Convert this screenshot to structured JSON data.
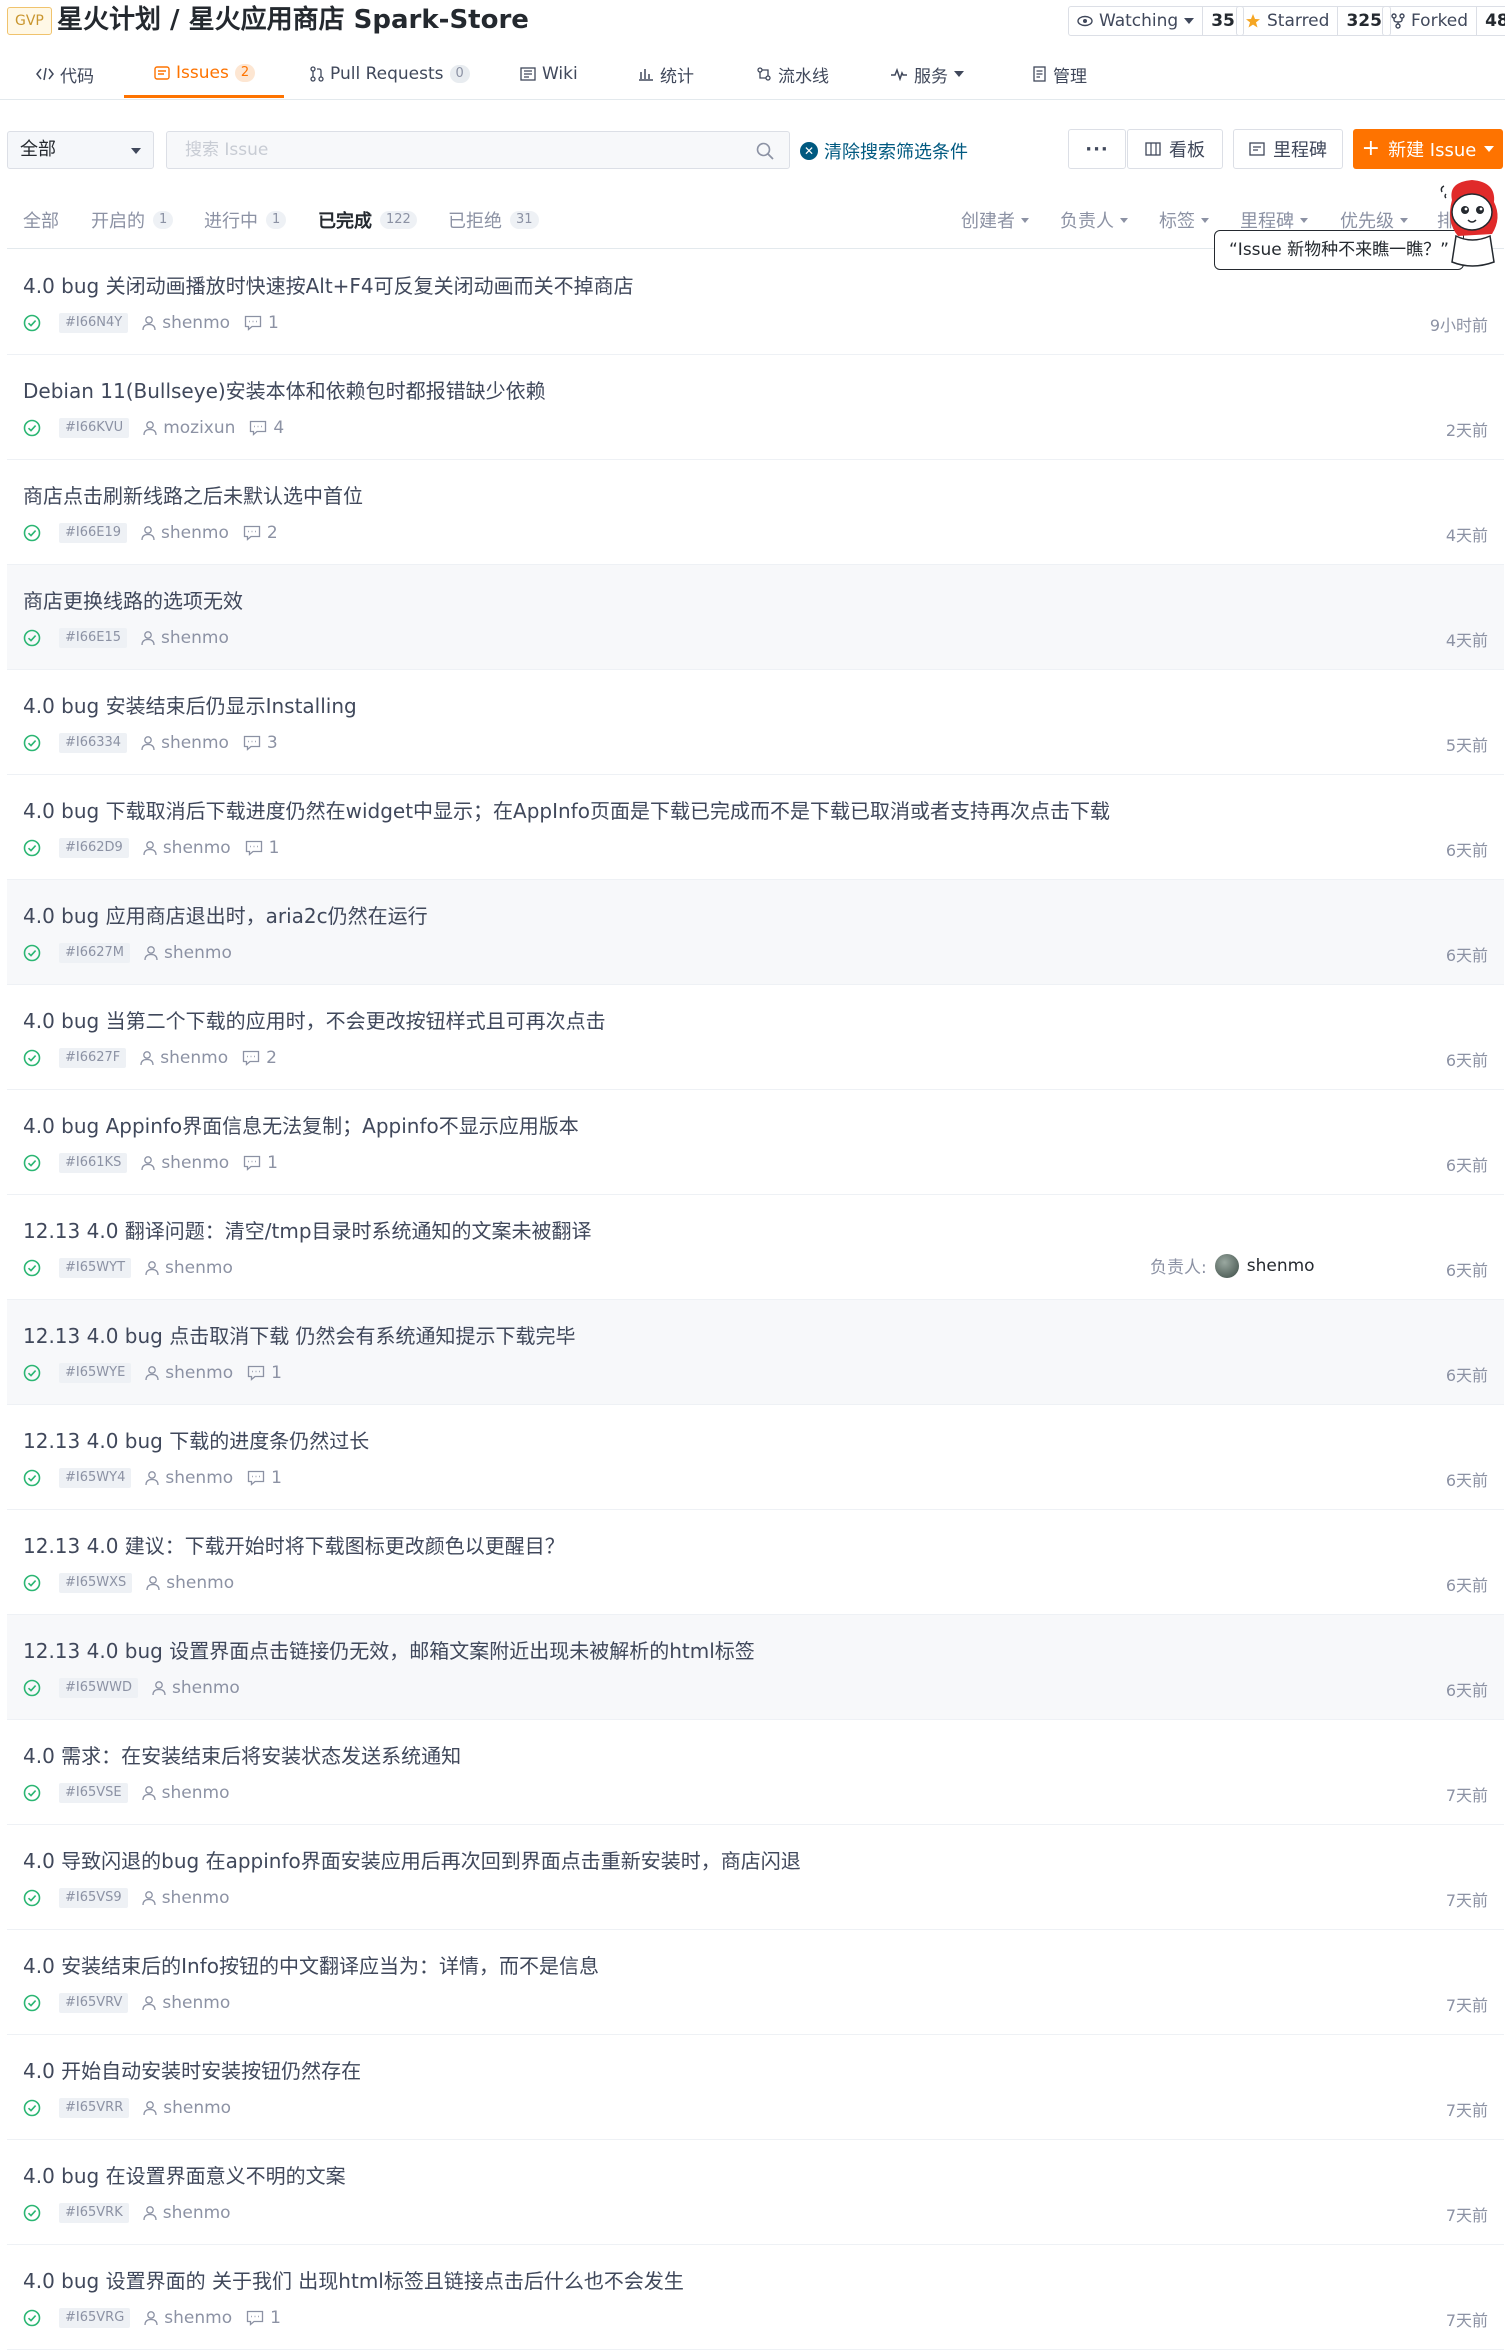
{
  "repo": {
    "badge": "GVP",
    "title": "星火计划 / 星火应用商店 Spark-Store"
  },
  "social": {
    "watching_label": "Watching",
    "watching_count": "35",
    "starred_label": "Starred",
    "starred_count": "325",
    "forked_label": "Forked",
    "forked_count": "48"
  },
  "tabs": {
    "code": "代码",
    "issues": "Issues",
    "issues_count": "2",
    "pulls": "Pull Requests",
    "pulls_count": "0",
    "wiki": "Wiki",
    "stats": "统计",
    "pipeline": "流水线",
    "services": "服务",
    "manage": "管理"
  },
  "toolbar": {
    "scope_value": "全部",
    "search_placeholder": "搜索 Issue",
    "clear_label": "清除搜索筛选条件",
    "more_label": "···",
    "board_label": "看板",
    "milestone_label": "里程碑",
    "new_issue_label": "新建 Issue"
  },
  "filters": {
    "all": "全部",
    "open": "开启的",
    "open_count": "1",
    "progress": "进行中",
    "progress_count": "1",
    "done": "已完成",
    "done_count": "122",
    "rejected": "已拒绝",
    "rejected_count": "31",
    "creator": "创建者",
    "assignee": "负责人",
    "labels": "标签",
    "milestone": "里程碑",
    "priority": "优先级",
    "sort_partial": "排"
  },
  "mascot": {
    "bubble": "“Issue 新物种不来瞧一瞧？”"
  },
  "issues": [
    {
      "title": "4.0 bug 关闭动画播放时快速按Alt+F4可反复关闭动画而关不掉商店",
      "id": "#I66N4Y",
      "author": "shenmo",
      "comments": "1",
      "time": "9小时前"
    },
    {
      "title": "Debian 11(Bullseye)安装本体和依赖包时都报错缺少依赖",
      "id": "#I66KVU",
      "author": "mozixun",
      "comments": "4",
      "time": "2天前"
    },
    {
      "title": "商店点击刷新线路之后未默认选中首位",
      "id": "#I66E19",
      "author": "shenmo",
      "comments": "2",
      "time": "4天前"
    },
    {
      "title": "商店更换线路的选项无效",
      "id": "#I66E15",
      "author": "shenmo",
      "comments": "",
      "time": "4天前"
    },
    {
      "title": "4.0 bug 安装结束后仍显示Installing",
      "id": "#I66334",
      "author": "shenmo",
      "comments": "3",
      "time": "5天前"
    },
    {
      "title": "4.0 bug 下载取消后下载进度仍然在widget中显示；在AppInfo页面是下载已完成而不是下载已取消或者支持再次点击下载",
      "id": "#I662D9",
      "author": "shenmo",
      "comments": "1",
      "time": "6天前"
    },
    {
      "title": "4.0 bug 应用商店退出时，aria2c仍然在运行",
      "id": "#I6627M",
      "author": "shenmo",
      "comments": "",
      "time": "6天前"
    },
    {
      "title": "4.0 bug 当第二个下载的应用时，不会更改按钮样式且可再次点击",
      "id": "#I6627F",
      "author": "shenmo",
      "comments": "2",
      "time": "6天前"
    },
    {
      "title": "4.0 bug Appinfo界面信息无法复制；Appinfo不显示应用版本",
      "id": "#I661KS",
      "author": "shenmo",
      "comments": "1",
      "time": "6天前"
    },
    {
      "title": "12.13 4.0 翻译问题：清空/tmp目录时系统通知的文案未被翻译",
      "id": "#I65WYT",
      "author": "shenmo",
      "comments": "",
      "time": "6天前",
      "assignee_label": "负责人:",
      "assignee": "shenmo"
    },
    {
      "title": "12.13 4.0 bug 点击取消下载 仍然会有系统通知提示下载完毕",
      "id": "#I65WYE",
      "author": "shenmo",
      "comments": "1",
      "time": "6天前"
    },
    {
      "title": "12.13 4.0 bug 下载的进度条仍然过长",
      "id": "#I65WY4",
      "author": "shenmo",
      "comments": "1",
      "time": "6天前"
    },
    {
      "title": "12.13 4.0 建议：下载开始时将下载图标更改颜色以更醒目？",
      "id": "#I65WXS",
      "author": "shenmo",
      "comments": "",
      "time": "6天前"
    },
    {
      "title": "12.13 4.0 bug 设置界面点击链接仍无效，邮箱文案附近出现未被解析的html标签",
      "id": "#I65WWD",
      "author": "shenmo",
      "comments": "",
      "time": "6天前"
    },
    {
      "title": "4.0 需求：在安装结束后将安装状态发送系统通知",
      "id": "#I65VSE",
      "author": "shenmo",
      "comments": "",
      "time": "7天前"
    },
    {
      "title": "4.0 导致闪退的bug 在appinfo界面安装应用后再次回到界面点击重新安装时，商店闪退",
      "id": "#I65VS9",
      "author": "shenmo",
      "comments": "",
      "time": "7天前"
    },
    {
      "title": "4.0 安装结束后的Info按钮的中文翻译应当为：详情，而不是信息",
      "id": "#I65VRV",
      "author": "shenmo",
      "comments": "",
      "time": "7天前"
    },
    {
      "title": "4.0 开始自动安装时安装按钮仍然存在",
      "id": "#I65VRR",
      "author": "shenmo",
      "comments": "",
      "time": "7天前"
    },
    {
      "title": "4.0 bug 在设置界面意义不明的文案",
      "id": "#I65VRK",
      "author": "shenmo",
      "comments": "",
      "time": "7天前"
    },
    {
      "title": "4.0 bug 设置界面的 关于我们 出现html标签且链接点击后什么也不会发生",
      "id": "#I65VRG",
      "author": "shenmo",
      "comments": "1",
      "time": "7天前"
    }
  ],
  "colors": {
    "accent": "#fe7300",
    "done_green": "#2bb673",
    "link_blue": "#005980",
    "muted": "#8c92a4"
  }
}
